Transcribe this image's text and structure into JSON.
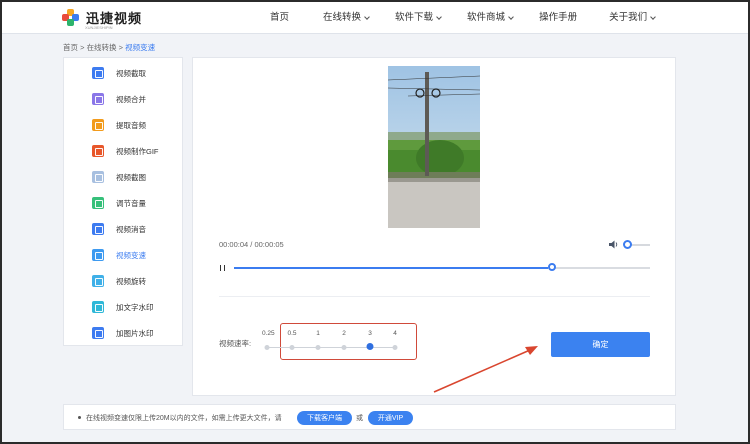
{
  "header": {
    "logo_text": "迅捷视频",
    "logo_sub": "XUNJIESHIPIN",
    "nav": [
      {
        "label": "首页",
        "dropdown": false
      },
      {
        "label": "在线转换",
        "dropdown": true
      },
      {
        "label": "软件下载",
        "dropdown": true
      },
      {
        "label": "软件商城",
        "dropdown": true
      },
      {
        "label": "操作手册",
        "dropdown": false
      },
      {
        "label": "关于我们",
        "dropdown": true
      }
    ]
  },
  "breadcrumb": {
    "home": "首页",
    "sep": " > ",
    "section": "在线转换",
    "current": "视频变速"
  },
  "sidebar": {
    "items": [
      {
        "label": "视频截取",
        "icon": "crop-icon",
        "color": "#3d7bf0",
        "active": false
      },
      {
        "label": "视频合并",
        "icon": "merge-icon",
        "color": "#8a76e8",
        "active": false
      },
      {
        "label": "提取音频",
        "icon": "headphone-icon",
        "color": "#f29b1c",
        "active": false
      },
      {
        "label": "视频制作GIF",
        "icon": "gif-icon",
        "color": "#e8572b",
        "active": false
      },
      {
        "label": "视频截图",
        "icon": "screenshot-icon",
        "color": "#a8c0e0",
        "active": false
      },
      {
        "label": "调节音量",
        "icon": "volume-icon",
        "color": "#36c07a",
        "active": false
      },
      {
        "label": "视频消音",
        "icon": "mute-icon",
        "color": "#3d7bf0",
        "active": false
      },
      {
        "label": "视频变速",
        "icon": "speed-icon",
        "color": "#3d9af0",
        "active": true
      },
      {
        "label": "视频旋转",
        "icon": "rotate-icon",
        "color": "#3fb0e8",
        "active": false
      },
      {
        "label": "加文字水印",
        "icon": "text-watermark-icon",
        "color": "#2fb8d8",
        "active": false
      },
      {
        "label": "加图片水印",
        "icon": "image-watermark-icon",
        "color": "#3d7bf0",
        "active": false
      }
    ]
  },
  "player": {
    "current_time": "00:00:04",
    "time_sep": " / ",
    "duration": "00:00:05",
    "progress": 0.8,
    "volume": 0.1
  },
  "speed": {
    "label": "视频速率:",
    "options": [
      "0.25",
      "0.5",
      "1",
      "2",
      "3",
      "4"
    ],
    "selected": "3"
  },
  "confirm_label": "确定",
  "notice": {
    "text": "在线视频变速仅限上传20M以内的文件，如需上传更大文件，请",
    "download_label": "下载客户端",
    "or": "或",
    "vip_label": "开通VIP"
  },
  "colors": {
    "accent": "#3b82f0",
    "highlight_box": "#d04a3a",
    "arrow": "#d9462f"
  }
}
